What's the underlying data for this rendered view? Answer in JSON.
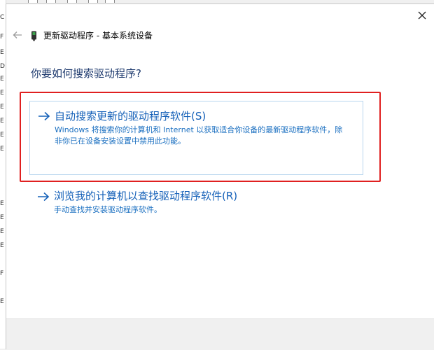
{
  "dialog": {
    "title": "更新驱动程序 - 基本系统设备",
    "question": "你要如何搜索驱动程序?",
    "close_icon": "close-icon",
    "back_icon": "back-arrow-icon"
  },
  "options": [
    {
      "title": "自动搜索更新的驱动程序软件(S)",
      "description": "Windows 将搜索你的计算机和 Internet 以获取适合你设备的最新驱动程序软件，除非你已在设备安装设置中禁用此功能。",
      "highlighted": true,
      "icon": "arrow-right-icon"
    },
    {
      "title": "浏览我的计算机以查找驱动程序软件(R)",
      "description": "手动查找并安装驱动程序软件。",
      "highlighted": false,
      "icon": "arrow-right-icon"
    }
  ],
  "colors": {
    "link": "#1460b8",
    "annotation_frame": "#e02020",
    "card_border": "#b9d6ee"
  },
  "background_window": {
    "fragments": [
      "C",
      "F",
      "E",
      "D",
      "E",
      "E",
      "E",
      "E",
      "E",
      "E",
      "E",
      "E",
      "E",
      "E",
      "F",
      "E"
    ]
  }
}
